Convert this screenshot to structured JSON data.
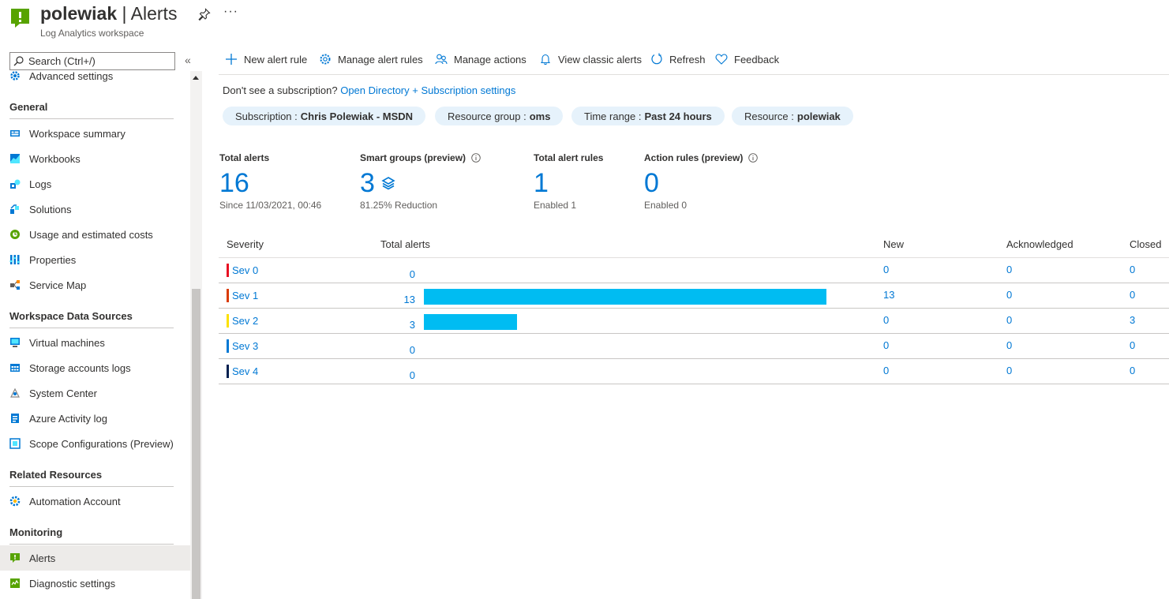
{
  "header": {
    "resource": "polewiak",
    "separator": "|",
    "page": "Alerts",
    "subtitle": "Log Analytics workspace",
    "more": "···",
    "logo_color": "#57a300"
  },
  "sidebar": {
    "search_placeholder": "Search (Ctrl+/)",
    "collapse": "«",
    "partial_item": "Advanced settings",
    "sections": [
      {
        "title": "General",
        "items": [
          "Workspace summary",
          "Workbooks",
          "Logs",
          "Solutions",
          "Usage and estimated costs",
          "Properties",
          "Service Map"
        ]
      },
      {
        "title": "Workspace Data Sources",
        "items": [
          "Virtual machines",
          "Storage accounts logs",
          "System Center",
          "Azure Activity log",
          "Scope Configurations (Preview)"
        ]
      },
      {
        "title": "Related Resources",
        "items": [
          "Automation Account"
        ]
      },
      {
        "title": "Monitoring",
        "items": [
          "Alerts",
          "Diagnostic settings"
        ]
      }
    ],
    "active_item": "Alerts"
  },
  "toolbar": {
    "new_alert_rule": "New alert rule",
    "manage_alert_rules": "Manage alert rules",
    "manage_actions": "Manage actions",
    "view_classic_alerts": "View classic alerts",
    "refresh": "Refresh",
    "feedback": "Feedback"
  },
  "subscription_note": {
    "text": "Don't see a subscription?",
    "link": "Open Directory + Subscription settings"
  },
  "filters": [
    {
      "label": "Subscription :",
      "value": "Chris Polewiak - MSDN"
    },
    {
      "label": "Resource group :",
      "value": "oms"
    },
    {
      "label": "Time range :",
      "value": "Past 24 hours"
    },
    {
      "label": "Resource :",
      "value": "polewiak"
    }
  ],
  "metrics": [
    {
      "label": "Total alerts",
      "value": "16",
      "caption": "Since 11/03/2021, 00:46"
    },
    {
      "label": "Smart groups (preview)",
      "value": "3",
      "caption": "81.25% Reduction"
    },
    {
      "label": "Total alert rules",
      "value": "1",
      "caption": "Enabled 1"
    },
    {
      "label": "Action rules (preview)",
      "value": "0",
      "caption": "Enabled 0"
    }
  ],
  "table": {
    "columns": [
      "Severity",
      "Total alerts",
      "New",
      "Acknowledged",
      "Closed"
    ],
    "max_total": 13,
    "rows": [
      {
        "severity": "Sev 0",
        "color": "#e81123",
        "total": "0",
        "total_n": 0,
        "new": "0",
        "ack": "0",
        "closed": "0"
      },
      {
        "severity": "Sev 1",
        "color": "#da3b01",
        "total": "13",
        "total_n": 13,
        "new": "13",
        "ack": "0",
        "closed": "0"
      },
      {
        "severity": "Sev 2",
        "color": "#fce100",
        "total": "3",
        "total_n": 3,
        "new": "0",
        "ack": "0",
        "closed": "3"
      },
      {
        "severity": "Sev 3",
        "color": "#0078d4",
        "total": "0",
        "total_n": 0,
        "new": "0",
        "ack": "0",
        "closed": "0"
      },
      {
        "severity": "Sev 4",
        "color": "#002050",
        "total": "0",
        "total_n": 0,
        "new": "0",
        "ack": "0",
        "closed": "0"
      }
    ],
    "bar_color": "#00bcf2"
  }
}
